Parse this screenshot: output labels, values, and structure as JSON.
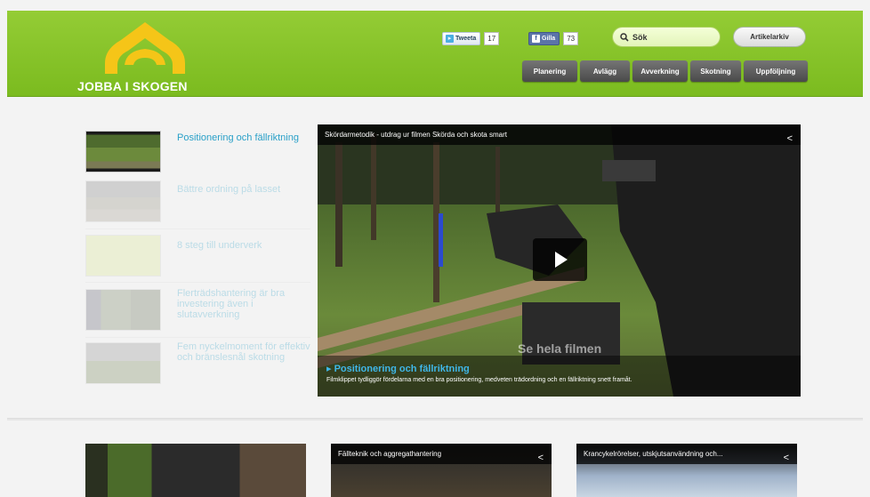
{
  "header": {
    "logo_text": "JOBBA I SKOGEN",
    "tweet_label": "Tweeta",
    "tweet_count": "17",
    "like_label": "Gilla",
    "like_count": "73",
    "search_placeholder": "Sök",
    "archive_label": "Artikelarkiv",
    "nav": [
      "Planering",
      "Avlägg",
      "Avverkning",
      "Skotning",
      "Uppföljning"
    ]
  },
  "playlist": [
    {
      "title": "Positionering och fällriktning",
      "active": true
    },
    {
      "title": "Bättre ordning på lasset",
      "active": false
    },
    {
      "title": "8 steg till underverk",
      "active": false
    },
    {
      "title": "Flerträdshantering är bra investering även i slutavverkning",
      "active": false
    },
    {
      "title": "Fem nyckelmoment för effektiv och bränslesnål skotning",
      "active": false
    }
  ],
  "video": {
    "top_title": "Skördarmetodik - utdrag ur filmen Skörda och skota smart",
    "overlay": "Se hela filmen",
    "bottom_title": "Positionering och fällriktning",
    "description": "Filmklippet tydliggör fördelarna med en bra positionering, medveten trädordning och en fällriktning snett framåt."
  },
  "cards": [
    {
      "caption": ""
    },
    {
      "caption": "Fällteknik och aggregathantering"
    },
    {
      "caption": "Krancykelrörelser, utskjutsanvändning och..."
    }
  ],
  "colors": {
    "header_green": "#86c42a",
    "link_blue": "#2aa0c8",
    "nav_gray": "#5a5a5a"
  }
}
